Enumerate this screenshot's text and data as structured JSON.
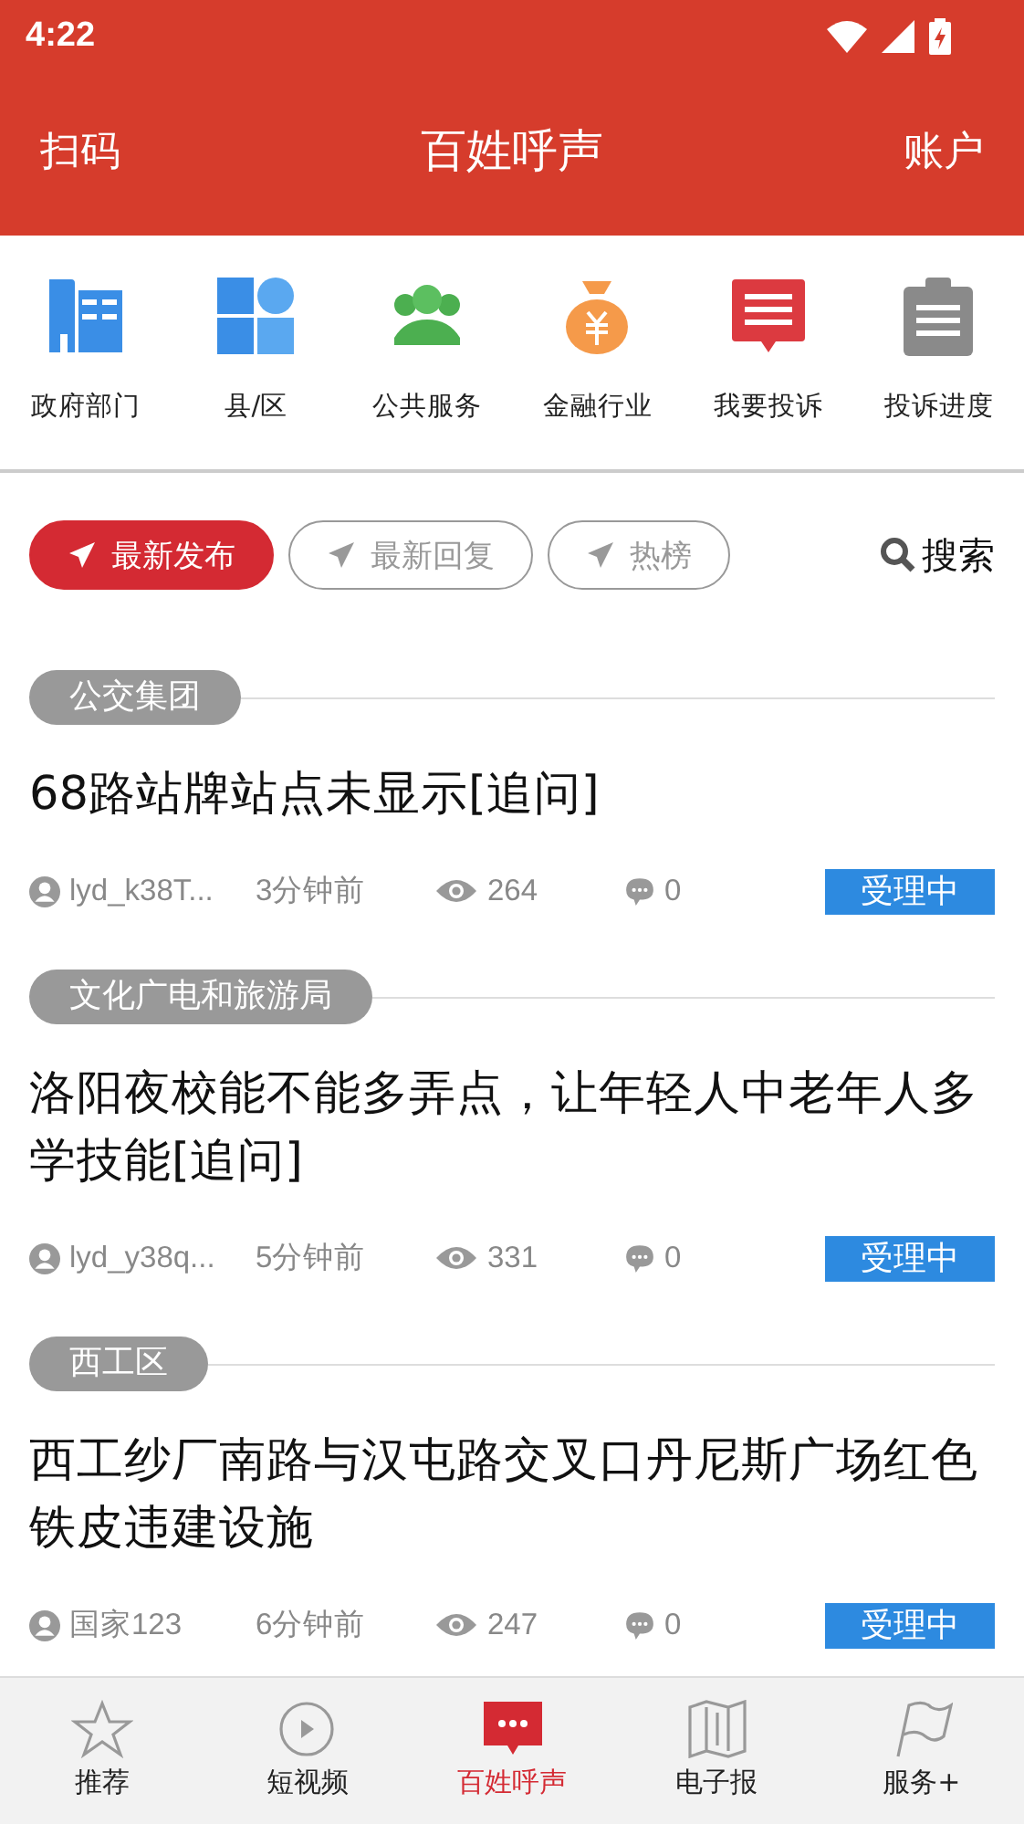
{
  "status_bar": {
    "time": "4:22"
  },
  "header": {
    "left": "扫码",
    "title": "百姓呼声",
    "right": "账户"
  },
  "categories": [
    {
      "kind": "building",
      "label": "政府部门"
    },
    {
      "kind": "blocks",
      "label": "县/区"
    },
    {
      "kind": "people",
      "label": "公共服务"
    },
    {
      "kind": "moneybag",
      "label": "金融行业"
    },
    {
      "kind": "complaint",
      "label": "我要投诉"
    },
    {
      "kind": "clipboard",
      "label": "投诉进度"
    }
  ],
  "filter_tabs": [
    {
      "label": "最新发布",
      "selected": true
    },
    {
      "label": "最新回复",
      "selected": false
    },
    {
      "label": "热榜",
      "selected": false
    }
  ],
  "search": {
    "label": "搜索"
  },
  "posts": [
    {
      "tag": "公交集团",
      "title": "68路站牌站点未显示[追问]",
      "user": "lyd_k38T...",
      "time": "3分钟前",
      "views": "264",
      "comments": "0",
      "status": "受理中"
    },
    {
      "tag": "文化广电和旅游局",
      "title": "洛阳夜校能不能多弄点，让年轻人中老年人多学技能[追问]",
      "user": "lyd_y38q...",
      "time": "5分钟前",
      "views": "331",
      "comments": "0",
      "status": "受理中"
    },
    {
      "tag": "西工区",
      "title": "西工纱厂南路与汉屯路交叉口丹尼斯广场红色铁皮违建设施",
      "user": "国家123",
      "time": "6分钟前",
      "views": "247",
      "comments": "0",
      "status": "受理中"
    }
  ],
  "bottom_nav": [
    {
      "kind": "star",
      "label": "推荐",
      "selected": false
    },
    {
      "kind": "play",
      "label": "短视频",
      "selected": false
    },
    {
      "kind": "chat",
      "label": "百姓呼声",
      "selected": true
    },
    {
      "kind": "map",
      "label": "电子报",
      "selected": false
    },
    {
      "kind": "flag",
      "label": "服务+",
      "selected": false
    }
  ]
}
